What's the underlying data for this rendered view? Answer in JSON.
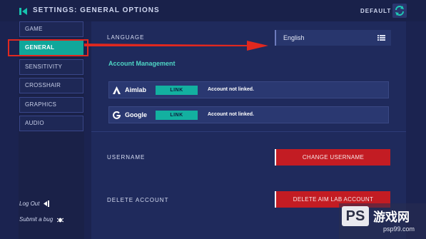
{
  "header": {
    "title": "SETTINGS: GENERAL OPTIONS",
    "default_label": "DEFAULT"
  },
  "sidebar": {
    "items": [
      {
        "label": "GAME"
      },
      {
        "label": "GENERAL"
      },
      {
        "label": "SENSITIVITY"
      },
      {
        "label": "CROSSHAIR"
      },
      {
        "label": "GRAPHICS"
      },
      {
        "label": "AUDIO"
      }
    ],
    "log_out": "Log Out",
    "submit_bug": "Submit a bug"
  },
  "language": {
    "label": "LANGUAGE",
    "value": "English"
  },
  "account_management": {
    "heading": "Account Management",
    "rows": [
      {
        "name": "Aimlab",
        "button": "LINK",
        "status": "Account not linked."
      },
      {
        "name": "Google",
        "button": "LINK",
        "status": "Account not linked."
      }
    ]
  },
  "username": {
    "label": "USERNAME",
    "button": "CHANGE USERNAME"
  },
  "delete_account": {
    "label": "DELETE ACCOUNT",
    "button": "DELETE AIM LAB ACCOUNT"
  },
  "watermark": {
    "logo": "PS",
    "brand": "游戏网",
    "url": "psp99.com"
  },
  "colors": {
    "accent": "#10a79a",
    "danger": "#c31c23",
    "annotation": "#e0281f"
  }
}
